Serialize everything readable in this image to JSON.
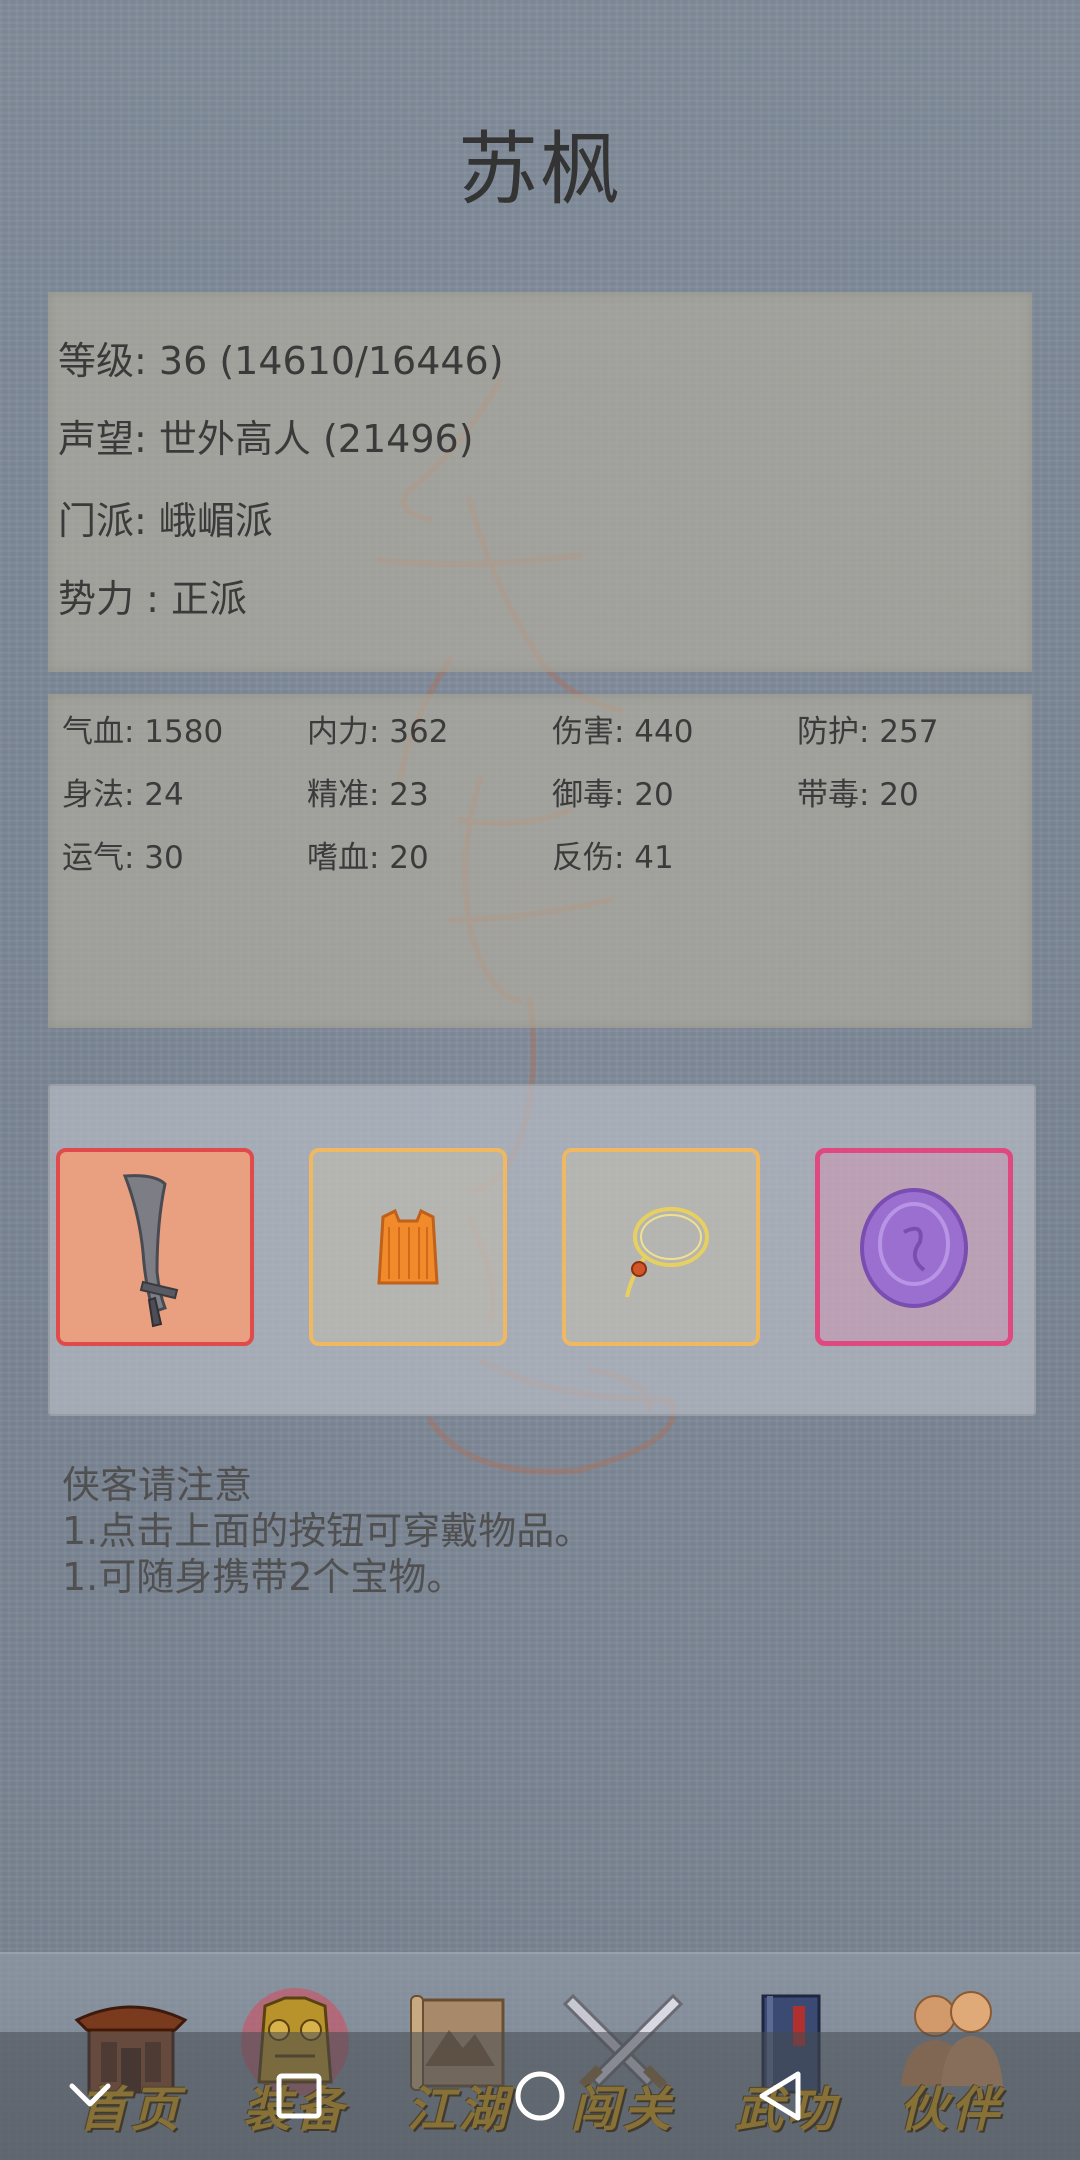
{
  "character": {
    "name": "苏枫"
  },
  "profile": {
    "level_label": "等级:",
    "level_value": "36 (14610/16446)",
    "fame_label": "声望:",
    "fame_value": "世外高人 (21496)",
    "sect_label": "门派:",
    "sect_value": "峨嵋派",
    "faction_label": "势力 :",
    "faction_value": "正派"
  },
  "stats": [
    {
      "text": "气血: 1580"
    },
    {
      "text": "内力: 362"
    },
    {
      "text": "伤害: 440"
    },
    {
      "text": "防护: 257"
    },
    {
      "text": "身法: 24"
    },
    {
      "text": "精准: 23"
    },
    {
      "text": "御毒: 20"
    },
    {
      "text": "带毒: 20"
    },
    {
      "text": "运气: 30"
    },
    {
      "text": "嗜血: 20"
    },
    {
      "text": "反伤: 41"
    }
  ],
  "equipment": {
    "slots": [
      {
        "item": "sword-icon",
        "border": "#e04a4a",
        "bg": "#e8a080"
      },
      {
        "item": "robe-icon",
        "border": "#f0b860",
        "bg": "rgba(200,190,170,0.45)"
      },
      {
        "item": "necklace-icon",
        "border": "#f0b860",
        "bg": "rgba(200,190,170,0.45)"
      },
      {
        "item": "purple-orb-icon",
        "border": "#e04880",
        "bg": "rgba(210,150,180,0.5)"
      }
    ]
  },
  "notice": {
    "title": "侠客请注意",
    "line1": "1.点击上面的按钮可穿戴物品。",
    "line2": "1.可随身携带2个宝物。"
  },
  "nav": {
    "items": [
      {
        "label": "首页",
        "icon": "temple-icon"
      },
      {
        "label": "装备",
        "icon": "armor-icon"
      },
      {
        "label": "江湖",
        "icon": "scroll-map-icon"
      },
      {
        "label": "闯关",
        "icon": "crossed-swords-icon"
      },
      {
        "label": "武功",
        "icon": "book-icon"
      },
      {
        "label": "伙伴",
        "icon": "companions-icon"
      }
    ]
  },
  "system_nav": {
    "buttons": [
      "collapse-icon",
      "home-square-icon",
      "circle-icon",
      "back-triangle-icon"
    ]
  },
  "colors": {
    "nav_label": "#d8a11a",
    "selected_slot_border": "#e04a4a",
    "treasure_slot_border": "#e04880",
    "normal_slot_border": "#f0b860"
  }
}
